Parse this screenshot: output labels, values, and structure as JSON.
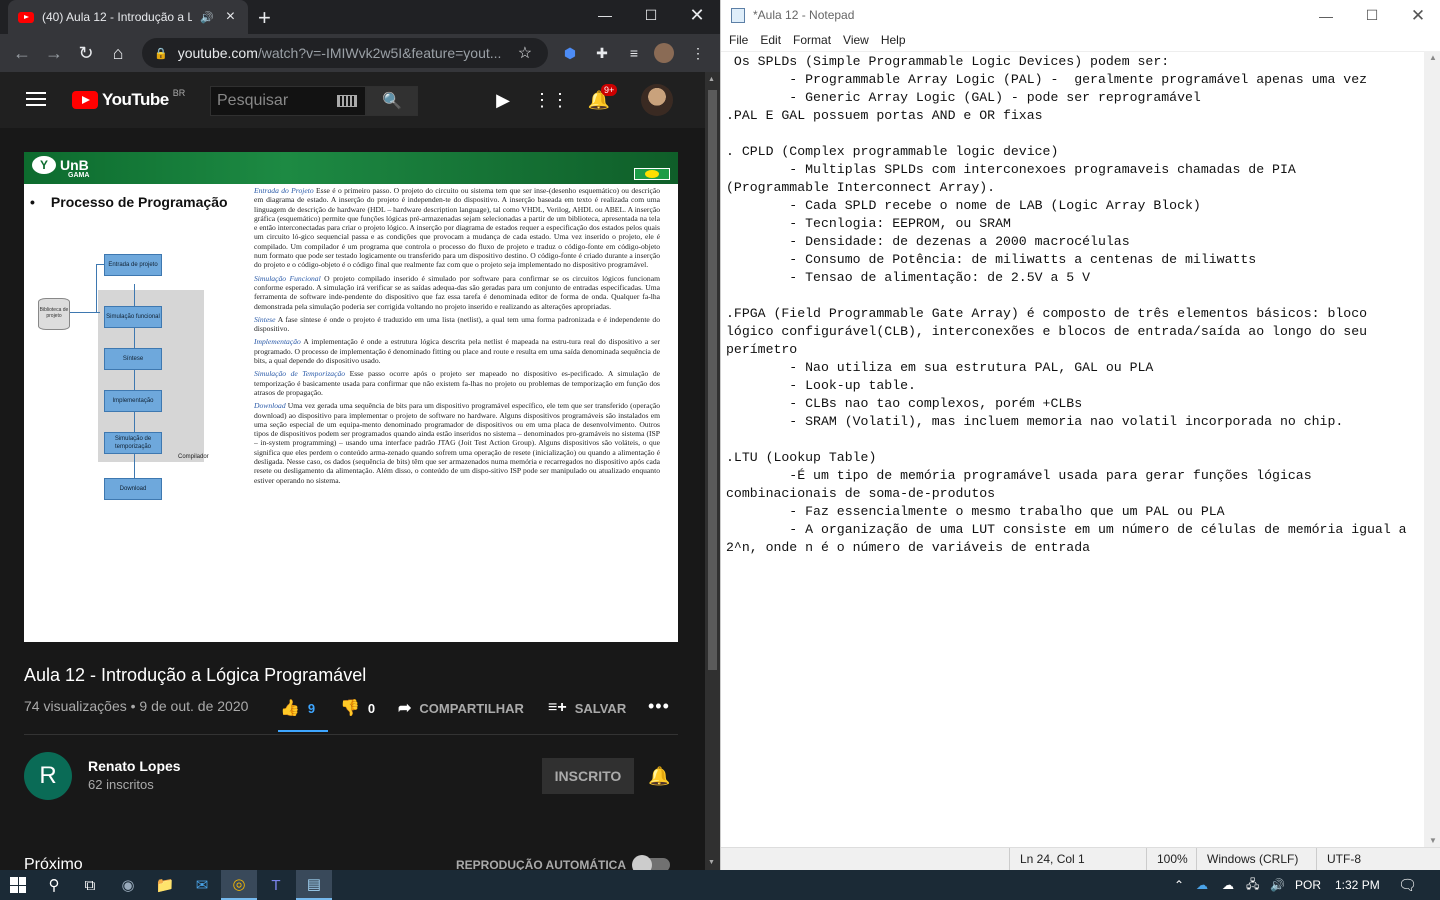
{
  "chrome": {
    "tab_title": "(40) Aula 12 - Introdução a L",
    "url_host": "youtube.com",
    "url_rest": "/watch?v=-IMIWvk2w5I&feature=yout...",
    "notif_count": "9+"
  },
  "youtube": {
    "logo_text": "YouTube",
    "logo_region": "BR",
    "search_placeholder": "Pesquisar",
    "video_title": "Aula 12 - Introdução a Lógica Programável",
    "views_date": "74 visualizações • 9 de out. de 2020",
    "likes": "9",
    "dislikes": "0",
    "share_label": "COMPARTILHAR",
    "save_label": "SALVAR",
    "channel_initial": "R",
    "channel_name": "Renato Lopes",
    "subscribers": "62 inscritos",
    "subscribed_label": "INSCRITO",
    "next_label": "Próximo",
    "autoplay_label": "REPRODUÇÃO AUTOMÁTICA",
    "accent_color": "#3ea6ff"
  },
  "slide": {
    "brand": "UnB",
    "brand_sub": "GAMA",
    "title": "Processo de Programação",
    "paragraphs": [
      {
        "head": "Entrada do Projeto",
        "text": " Esse é o primeiro passo. O projeto do circuito ou sistema tem que ser inse-(desenho esquemático) ou descrição em diagrama de estado. A inserção do projeto é independen-te do dispositivo. A inserção baseada em texto é realizada com uma linguagem de descrição de hardware (HDL – hardware description language), tal como VHDL, Verilog, AHDL ou ABEL. A inserção gráfica (esquemático) permite que funções lógicas pré-armazenadas sejam selecionadas a partir de um biblioteca, apresentada na tela e então interconectadas para criar o projeto lógico. A inserção por diagrama de estados requer a especificação dos estados pelos quais um circuito ló-gico sequencial passa e as condições que provocam a mudança de cada estado. Uma vez inserido o projeto, ele é compilado. Um compilador é um programa que controla o processo do fluxo de projeto e traduz o código-fonte em código-objeto num formato que pode ser testado logicamente ou transferido para um dispositivo destino. O código-fonte é criado durante a inserção do projeto e o código-objeto é o código final que realmente faz com que o projeto seja implementado no dispositivo programável."
      },
      {
        "head": "Simulação Funcional",
        "text": " O projeto compilado inserido é simulado por software para confirmar se os circuitos lógicos funcionam conforme esperado. A simulação irá verificar se as saídas adequa-das são geradas para um conjunto de entradas especificadas. Uma ferramenta de software inde-pendente do dispositivo que faz essa tarefa é denominada editor de forma de onda. Qualquer fa-lha demonstrada pela simulação poderia ser corrigida voltando no projeto inserido e realizando as alterações apropriadas."
      },
      {
        "head": "Síntese",
        "text": " A fase síntese é onde o projeto é traduzido em uma lista (netlist), a qual tem uma forma padronizada e é independente do dispositivo."
      },
      {
        "head": "Implementação",
        "text": " A implementação é onde a estrutura lógica descrita pela netlist é mapeada na estru-tura real do dispositivo a ser programado. O processo de implementação é denominado fitting ou place and route e resulta em uma saída denominada sequência de bits, a qual depende do dispositivo usado."
      },
      {
        "head": "Simulação de Temporização",
        "text": " Esse passo ocorre após o projeto ser mapeado no dispositivo es-pecificado. A simulação de temporização é basicamente usada para confirmar que não existem fa-lhas no projeto ou problemas de temporização em função dos atrasos de propagação."
      },
      {
        "head": "Download",
        "text": " Uma vez gerada uma sequência de bits para um dispositivo programável específico, ele tem que ser transferido (operação download) ao dispositivo para implementar o projeto de software no hardware. Alguns dispositivos programáveis são instalados em uma seção especial de um equipa-mento denominado programador de dispositivos ou em uma placa de desenvolvimento. Outros tipos de dispositivos podem ser programados quando ainda estão inseridos no sistema – denominados pro-gramáveis no sistema (ISP – in-system programming) – usando uma interface padrão JTAG (Joit Test Action Group). Alguns dispositivos são voláteis, o que significa que eles perdem o conteúdo arma-zenado quando sofrem uma operação de resete (inicialização) ou quando a alimentação é desligada. Nesse caso, os dados (sequência de bits) têm que ser armazenados numa memória e recarregados no dispositivo após cada resete ou desligamento da alimentação. Além disso, o conteúdo de um dispo-sitivo ISP pode ser manipulado ou atualizado enquanto estiver operando no sistema."
      }
    ],
    "diagram": {
      "library": "Biblioteca de projeto",
      "steps": [
        "Entrada de projeto",
        "Simulação funcional",
        "Síntese",
        "Implementação",
        "Simulação de temporização",
        "Download"
      ],
      "compiler": "Compilador"
    }
  },
  "notepad": {
    "title": "*Aula 12 - Notepad",
    "menu": [
      "File",
      "Edit",
      "Format",
      "View",
      "Help"
    ],
    "text": " Os SPLDs (Simple Programmable Logic Devices) podem ser:\n        - Programmable Array Logic (PAL) -  geralmente programável apenas uma vez\n        - Generic Array Logic (GAL) - pode ser reprogramável\n.PAL E GAL possuem portas AND e OR fixas\n\n. CPLD (Complex programmable logic device)\n        - Multiplas SPLDs com interconexoes programaveis chamadas de PIA\n(Programmable Interconnect Array).\n        - Cada SPLD recebe o nome de LAB (Logic Array Block)\n        - Tecnlogia: EEPROM, ou SRAM\n        - Densidade: de dezenas a 2000 macrocélulas\n        - Consumo de Potência: de miliwatts a centenas de miliwatts\n        - Tensao de alimentação: de 2.5V a 5 V\n\n.FPGA (Field Programmable Gate Array) é composto de três elementos básicos: bloco\nlógico configurável(CLB), interconexões e blocos de entrada/saída ao longo do seu\nperímetro\n        - Nao utiliza em sua estrutura PAL, GAL ou PLA\n        - Look-up table.\n        - CLBs nao tao complexos, porém +CLBs\n        - SRAM (Volatil), mas incluem memoria nao volatil incorporada no chip.\n\n.LTU (Lookup Table)\n        -É um tipo de memória programável usada para gerar funções lógicas\ncombinacionais de soma-de-produtos\n        - Faz essencialmente o mesmo trabalho que um PAL ou PLA\n        - A organização de uma LUT consiste em um número de células de memória igual a\n2^n, onde n é o número de variáveis de entrada",
    "status_position": "Ln 24, Col 1",
    "status_zoom": "100%",
    "status_eol": "Windows (CRLF)",
    "status_encoding": "UTF-8"
  },
  "taskbar": {
    "language": "POR",
    "time": "1:32 PM"
  }
}
